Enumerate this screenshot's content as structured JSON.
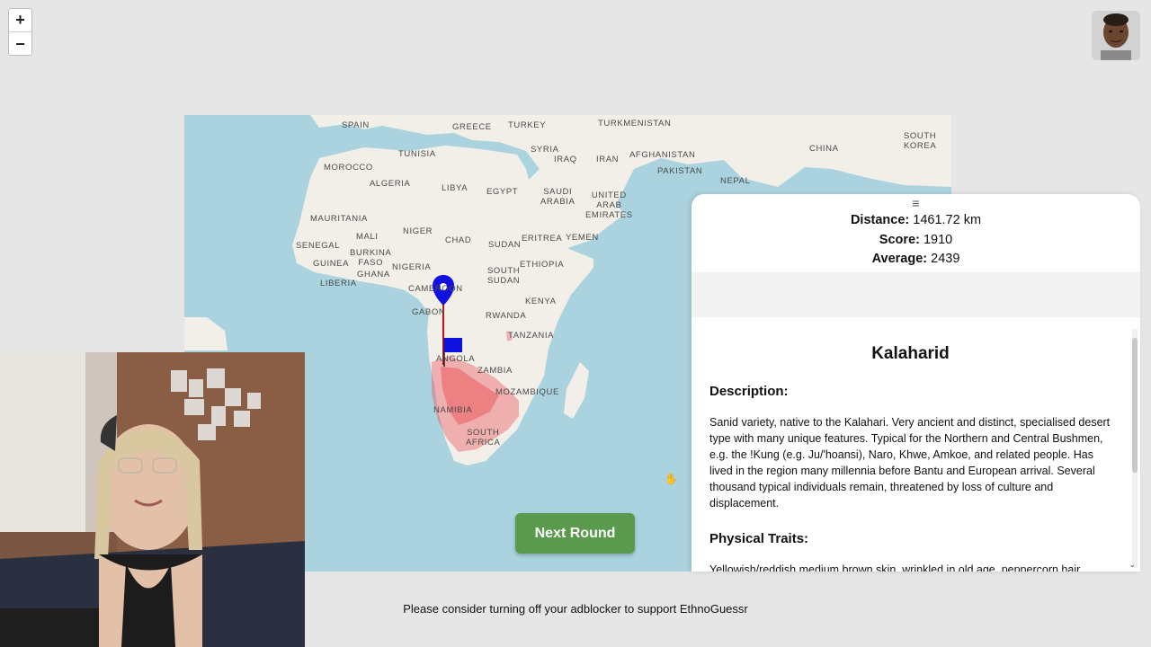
{
  "zoom": {
    "in_label": "+",
    "out_label": "−"
  },
  "map": {
    "labels": [
      {
        "text": "SPAIN",
        "id": "spain"
      },
      {
        "text": "GREECE",
        "id": "greece"
      },
      {
        "text": "TURKEY",
        "id": "turkey"
      },
      {
        "text": "TURKMENISTAN",
        "id": "turkmenistan"
      },
      {
        "text": "CHINA",
        "id": "china"
      },
      {
        "text": "SOUTH\nKOREA",
        "id": "south-korea"
      },
      {
        "text": "TUNISIA",
        "id": "tunisia"
      },
      {
        "text": "SYRIA",
        "id": "syria"
      },
      {
        "text": "IRAQ",
        "id": "iraq"
      },
      {
        "text": "IRAN",
        "id": "iran"
      },
      {
        "text": "AFGHANISTAN",
        "id": "afghanistan"
      },
      {
        "text": "MOROCCO",
        "id": "morocco"
      },
      {
        "text": "PAKISTAN",
        "id": "pakistan"
      },
      {
        "text": "ALGERIA",
        "id": "algeria"
      },
      {
        "text": "LIBYA",
        "id": "libya"
      },
      {
        "text": "EGYPT",
        "id": "egypt"
      },
      {
        "text": "SAUDI\nARABIA",
        "id": "saudi-arabia"
      },
      {
        "text": "UNITED\nARAB\nEMIRATES",
        "id": "uae"
      },
      {
        "text": "NEPAL",
        "id": "nepal"
      },
      {
        "text": "MAURITANIA",
        "id": "mauritania"
      },
      {
        "text": "MALI",
        "id": "mali"
      },
      {
        "text": "NIGER",
        "id": "niger"
      },
      {
        "text": "CHAD",
        "id": "chad"
      },
      {
        "text": "SUDAN",
        "id": "sudan"
      },
      {
        "text": "ERITREA",
        "id": "eritrea"
      },
      {
        "text": "YEMEN",
        "id": "yemen"
      },
      {
        "text": "SENEGAL",
        "id": "senegal"
      },
      {
        "text": "BURKINA\nFASO",
        "id": "burkina-faso"
      },
      {
        "text": "GUINEA",
        "id": "guinea"
      },
      {
        "text": "GHANA",
        "id": "ghana"
      },
      {
        "text": "NIGERIA",
        "id": "nigeria"
      },
      {
        "text": "ETHIOPIA",
        "id": "ethiopia"
      },
      {
        "text": "SOUTH\nSUDAN",
        "id": "south-sudan"
      },
      {
        "text": "LIBERIA",
        "id": "liberia"
      },
      {
        "text": "CAMEROON",
        "id": "cameroon"
      },
      {
        "text": "GABON",
        "id": "gabon"
      },
      {
        "text": "RWANDA",
        "id": "rwanda"
      },
      {
        "text": "KENYA",
        "id": "kenya"
      },
      {
        "text": "TANZANIA",
        "id": "tanzania"
      },
      {
        "text": "ANGOLA",
        "id": "angola"
      },
      {
        "text": "ZAMBIA",
        "id": "zambia"
      },
      {
        "text": "MOZAMBIQUE",
        "id": "mozambique"
      },
      {
        "text": "NAMIBIA",
        "id": "namibia"
      },
      {
        "text": "SOUTH\nAFRICA",
        "id": "south-africa"
      }
    ]
  },
  "results": {
    "handle": "≡",
    "distance_label": "Distance:",
    "distance_value": "1461.72 km",
    "score_label": "Score:",
    "score_value": "1910",
    "average_label": "Average:",
    "average_value": "2439"
  },
  "info": {
    "title": "Kalaharid",
    "description_heading": "Description:",
    "description_text": "Sanid variety, native to the Kalahari. Very ancient and distinct, specialised desert type with many unique features. Typical for the Northern and Central Bushmen, e.g. the !Kung (e.g. Ju/'hoansi), Naro, Khwe, Amkoe, and related people. Has lived in the region many millennia before Bantu and European arrival. Several thousand typical individuals remain, threatened by loss of culture and displacement.",
    "traits_heading": "Physical Traits:",
    "traits_text": "Yellowish/reddish medium brown skin, wrinkled in old age, peppercorn hair"
  },
  "next_button_label": "Next Round",
  "ad_notice": "Please consider turning off your adblocker to support EthnoGuessr",
  "colors": {
    "water": "#aad3df",
    "land": "#f2efe9",
    "region_fill": "#e8474f",
    "pin": "#1010e0",
    "line": "#d01010",
    "button": "#5a9a4c"
  }
}
